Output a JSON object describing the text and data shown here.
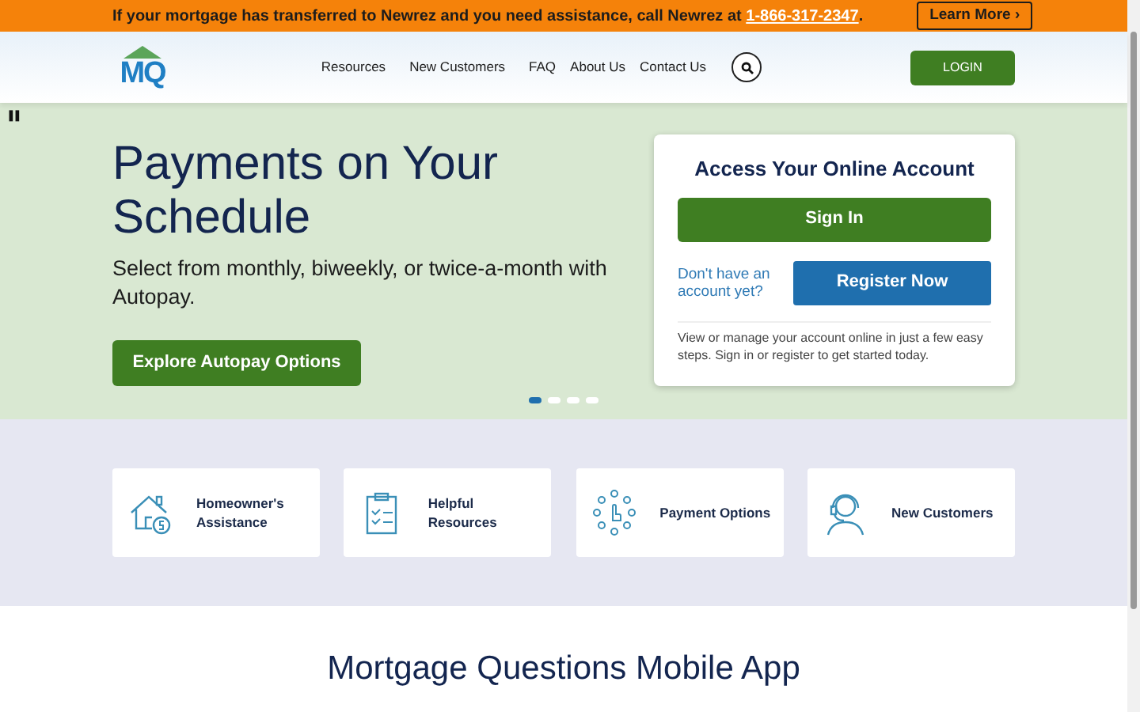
{
  "banner": {
    "text": "If your mortgage has transferred to Newrez and you need assistance, call Newrez at",
    "phone": "1-866-317-2347",
    "end": ".",
    "button": "Learn More ›"
  },
  "logo": {
    "text": "MQ"
  },
  "nav": [
    {
      "label": "Resources"
    },
    {
      "label": "New Customers"
    },
    {
      "label": "FAQ"
    },
    {
      "label": "About Us"
    },
    {
      "label": "Contact Us"
    }
  ],
  "login": "LOGIN",
  "hero": {
    "pause": "❚❚",
    "title": "Payments on Your Schedule",
    "subtitle": "Select from monthly, biweekly, or twice-a-month with Autopay.",
    "button": "Explore Autopay Options",
    "dots": [
      {
        "selected": true
      },
      {
        "selected": false
      },
      {
        "selected": false
      },
      {
        "selected": false
      }
    ]
  },
  "account": {
    "title": "Access Your Online Account",
    "sign_in": "Sign In",
    "prompt": "Don't have an account yet?",
    "register": "Register Now",
    "note": "View or manage your account online in just a few easy steps. Sign in or register to get started today."
  },
  "tiles": [
    {
      "kind": "house",
      "label": "Homeowner's Assistance"
    },
    {
      "kind": "clipboard",
      "label": "Helpful Resources"
    },
    {
      "kind": "payment",
      "label": "Payment Options"
    },
    {
      "kind": "headset",
      "label": "New Customers"
    }
  ],
  "app_section": {
    "title": "Mortgage Questions Mobile App"
  }
}
